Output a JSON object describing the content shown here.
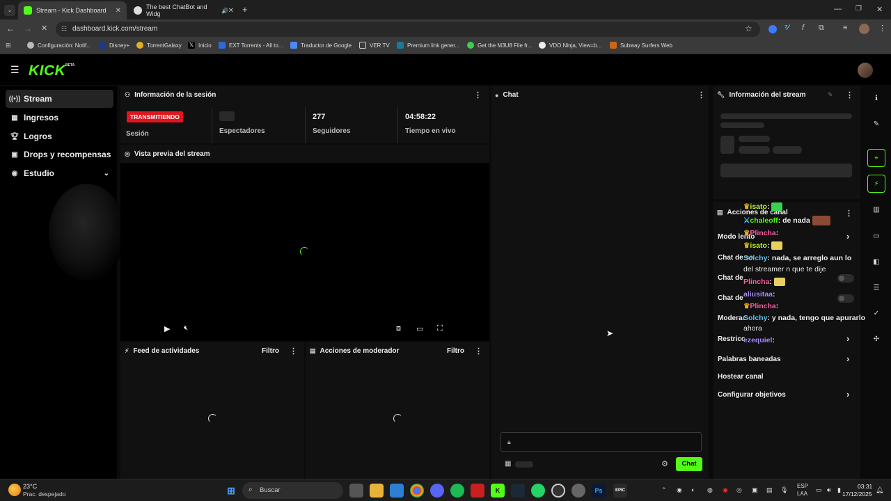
{
  "browser": {
    "tabs": [
      {
        "label": "Stream - Kick Dashboard",
        "active": true
      },
      {
        "label": "The best ChatBot and Widg",
        "active": false
      }
    ],
    "url": "dashboard.kick.com/stream",
    "bookmarks": [
      "Configuración: Notif...",
      "Disney+",
      "TorrentGalaxy",
      "Inicio",
      "EXT Torrents - All to...",
      "Traductor de Google",
      "VER TV",
      "Premium link gener...",
      "Get the M3U8 File fr...",
      "VDO.Ninja, View=b...",
      "Subway Surfers Web"
    ]
  },
  "app": {
    "logo": "KICK",
    "logo_badge": "BETA",
    "accent": "#53fc18",
    "sidebar": {
      "items": [
        {
          "label": "Stream",
          "icon": "broadcast-icon"
        },
        {
          "label": "Ingresos",
          "icon": "chart-icon"
        },
        {
          "label": "Logros",
          "icon": "trophy-icon"
        },
        {
          "label": "Drops y recompensas",
          "icon": "gift-icon"
        },
        {
          "label": "Estudio",
          "icon": "studio-icon"
        }
      ]
    },
    "session": {
      "title": "Información de la sesión",
      "badge": "TRANSMITIENDO",
      "session_label": "Sesión",
      "viewers_label": "Espectadores",
      "followers_value": "277",
      "followers_label": "Seguidores",
      "live_time_value": "04:58:22",
      "live_time_label": "Tiempo en vivo"
    },
    "preview": {
      "title": "Vista previa del stream"
    },
    "activity_feed": {
      "title": "Feed de actividades",
      "filter": "Filtro"
    },
    "mod_actions": {
      "title": "Acciones de moderador",
      "filter": "Filtro"
    },
    "chat": {
      "title": "Chat",
      "send_label": "Chat"
    },
    "stream_info": {
      "title": "Información del stream"
    },
    "channel_actions": {
      "title": "Acciones de canal",
      "rows": [
        "Modo lento",
        "Chat de solo seguidores",
        "Chat de solo suscriptores",
        "Chat de solo emotes",
        "Moderación",
        "Restricciones de edad",
        "Palabras baneadas",
        "Hostear canal",
        "Configurar objetivos"
      ],
      "rows_visible": [
        "Modo lento",
        "Chat de so",
        "Chat de",
        "Chat de",
        "Moderac",
        "Restricc",
        "Palabras baneadas",
        "Hostear canal",
        "Configurar objetivos"
      ]
    },
    "overlay_chat": [
      {
        "user": "isato",
        "text": ""
      },
      {
        "user": "chaleoff",
        "text": "de nada"
      },
      {
        "user": "Plincha",
        "text": ""
      },
      {
        "user": "isato",
        "text": ""
      },
      {
        "user": "Solchy",
        "text": "nada, se arreglo aun lo"
      },
      {
        "user": "",
        "text": "del streamer n que te dije"
      },
      {
        "user": "Plincha",
        "text": ""
      },
      {
        "user": "aliusitaa",
        "text": ""
      },
      {
        "user": "Plincha",
        "text": ""
      },
      {
        "user": "Solchy",
        "text": "y nada, tengo que apurarlo"
      },
      {
        "user": "",
        "text": "ahora"
      },
      {
        "user": "ezequiel",
        "text": ""
      }
    ]
  },
  "taskbar": {
    "weather_temp": "23°C",
    "weather_desc": "Prac. despejado",
    "search_placeholder": "Buscar",
    "lang": "ESP",
    "lang2": "LAA",
    "time": "03:31",
    "date": "17/12/2025"
  }
}
